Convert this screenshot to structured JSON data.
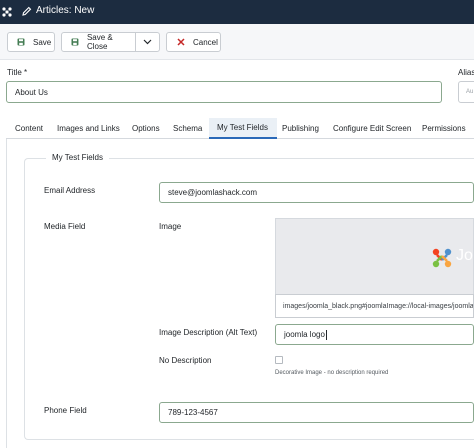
{
  "header": {
    "title": "Articles: New",
    "logo_icon": "joomla-logo-icon",
    "edit_icon": "pencil-icon"
  },
  "toolbar": {
    "save_label": "Save",
    "save_close_label": "Save & Close",
    "cancel_label": "Cancel",
    "dropdown_icon": "chevron-down-icon",
    "save_icon_color": "#457d54",
    "cancel_icon_color": "#c52827"
  },
  "form": {
    "title_label": "Title *",
    "title_value": "About Us",
    "alias_label": "Alias",
    "alias_placeholder": "Au"
  },
  "tabs": [
    {
      "label": "Content",
      "active": false
    },
    {
      "label": "Images and Links",
      "active": false
    },
    {
      "label": "Options",
      "active": false
    },
    {
      "label": "Schema",
      "active": false
    },
    {
      "label": "My Test Fields",
      "active": true
    },
    {
      "label": "Publishing",
      "active": false
    },
    {
      "label": "Configure Edit Screen",
      "active": false
    },
    {
      "label": "Permissions",
      "active": false
    }
  ],
  "fieldset": {
    "legend": "My Test Fields",
    "email_label": "Email Address",
    "email_value": "steve@joomlashack.com",
    "media_label": "Media Field",
    "image_label": "Image",
    "image_preview_text": "Jo",
    "image_path": "images/joomla_black.png#joomlaImage://local-images/joomla_black.png",
    "alt_label": "Image Description (Alt Text)",
    "alt_value": "joomla logo",
    "no_description_label": "No Description",
    "no_description_checked": false,
    "decorative_help": "Decorative Image - no description required",
    "phone_label": "Phone Field",
    "phone_value": "789-123-4567"
  }
}
